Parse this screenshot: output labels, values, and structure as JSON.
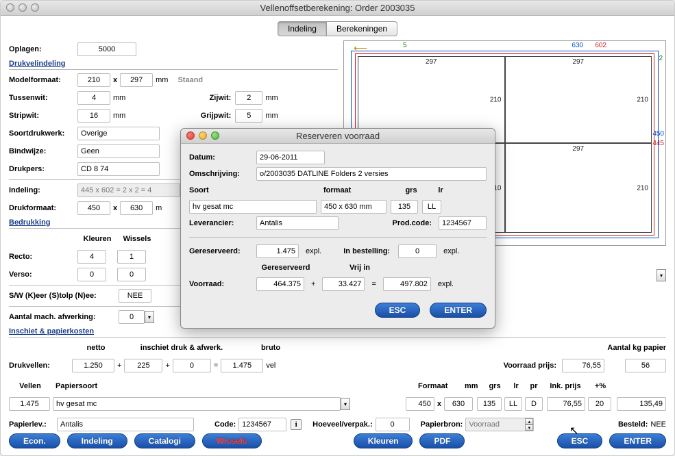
{
  "window_title": "Vellenoffsetberekening: Order 2003035",
  "tabs": {
    "indeling": "Indeling",
    "berekeningen": "Berekeningen"
  },
  "left": {
    "oplagen_label": "Oplagen:",
    "oplagen_value": "5000",
    "section_drukvel": "Drukvelindeling",
    "modelformaat_label": "Modelformaat:",
    "model_w": "210",
    "model_h": "297",
    "model_unit": "mm",
    "orient": "Staand",
    "tussenwit_label": "Tussenwit:",
    "tussenwit": "4",
    "zijwit_label": "Zijwit:",
    "zijwit": "2",
    "stripwit_label": "Stripwit:",
    "stripwit": "16",
    "grijpwit_label": "Grijpwit:",
    "grijpwit": "5",
    "soortdrukwerk_label": "Soortdrukwerk:",
    "soortdrukwerk": "Overige",
    "bindwijze_label": "Bindwijze:",
    "bindwijze": "Geen",
    "drukpers_label": "Drukpers:",
    "drukpers": "CD 8 74",
    "indeling_label": "Indeling:",
    "indeling_expr": "445 x 602 = 2 x 2 = 4",
    "drukformaat_label": "Drukformaat:",
    "druk_w": "450",
    "druk_h": "630",
    "section_bedrukking": "Bedrukking",
    "kleuren_hdr": "Kleuren",
    "wissels_hdr": "Wissels",
    "recto_label": "Recto:",
    "recto_k": "4",
    "recto_w": "1",
    "verso_label": "Verso:",
    "verso_k": "0",
    "verso_w": "0",
    "sw_label": "S/W (K)eer (S)tolp (N)ee:",
    "sw_val": "NEE",
    "aantal_label": "Aantal mach. afwerking:",
    "aantal_val": "0",
    "section_inschiet": "Inschiet & papierkosten",
    "netto_hdr": "netto",
    "inschiet_hdr": "inschiet druk & afwerk.",
    "bruto_hdr": "bruto",
    "drukvellen_label": "Drukvellen:",
    "dv_netto": "1.250",
    "dv_a": "225",
    "dv_b": "0",
    "dv_bruto": "1.475",
    "vel": "vel",
    "voorraadprijs_label": "Voorraad prijs:",
    "voorraadprijs": "76,55",
    "kgpapier_label": "Aantal kg papier",
    "kgpapier": "56",
    "vellen_hdr": "Vellen",
    "papiersoort_hdr": "Papiersoort",
    "formaat_hdr": "Formaat",
    "mm": "mm",
    "grs_hdr": "grs",
    "lr_hdr": "lr",
    "pr_hdr": "pr",
    "inkprijs_hdr": "Ink. prijs",
    "pct_hdr": "+%",
    "vellen": "1.475",
    "papiersoort": "hv gesat mc",
    "fmt_w": "450",
    "x": "x",
    "fmt_h": "630",
    "grs": "135",
    "lr": "LL",
    "pr": "D",
    "inkprijs": "76,55",
    "pct": "20",
    "totaal": "135,49",
    "papierlev_label": "Papierlev.:",
    "papierlev": "Antalis",
    "code_label": "Code:",
    "code": "1234567",
    "hoeveel_label": "Hoeveel/verpak.:",
    "hoeveel": "0",
    "papierbron_label": "Papierbron:",
    "papierbron": "Voorraad",
    "besteld_label": "Besteld:",
    "besteld": "NEE"
  },
  "sheet": {
    "top_630": "630",
    "top_602": "602",
    "top_5": "5",
    "w_297": "297",
    "h_210": "210",
    "right_2": "2",
    "right_450": "450",
    "right_445": "445"
  },
  "dialog": {
    "title": "Reserveren voorraad",
    "datum_label": "Datum:",
    "datum": "29-06-2011",
    "omschrijving_label": "Omschrijving:",
    "omschrijving": "o/2003035 DATLINE Folders 2 versies",
    "soort_hdr": "Soort",
    "formaat_hdr": "formaat",
    "grs_hdr": "grs",
    "lr_hdr": "lr",
    "soort": "hv gesat mc",
    "formaat": "450 x 630 mm",
    "grs": "135",
    "lr": "LL",
    "leverancier_label": "Leverancier:",
    "leverancier": "Antalis",
    "prodcode_label": "Prod.code:",
    "prodcode": "1234567",
    "gereserveerd_label": "Gereserveerd:",
    "gereserveerd": "1.475",
    "expl": "expl.",
    "inbestelling_label": "In bestelling:",
    "inbestelling": "0",
    "voorraad_label": "Voorraad:",
    "gereserveerd_hdr": "Gereserveerd",
    "vrij_hdr": "Vrij in",
    "voorraad_a": "464.375",
    "voorraad_b": "33.427",
    "voorraad_sum": "497.802",
    "esc": "ESC",
    "enter": "ENTER"
  },
  "buttons": {
    "econ": "Econ.",
    "indeling": "Indeling",
    "catalogi": "Catalogi",
    "wissels": "Wissels",
    "kleuren": "Kleuren",
    "pdf": "PDF",
    "esc": "ESC",
    "enter": "ENTER"
  }
}
